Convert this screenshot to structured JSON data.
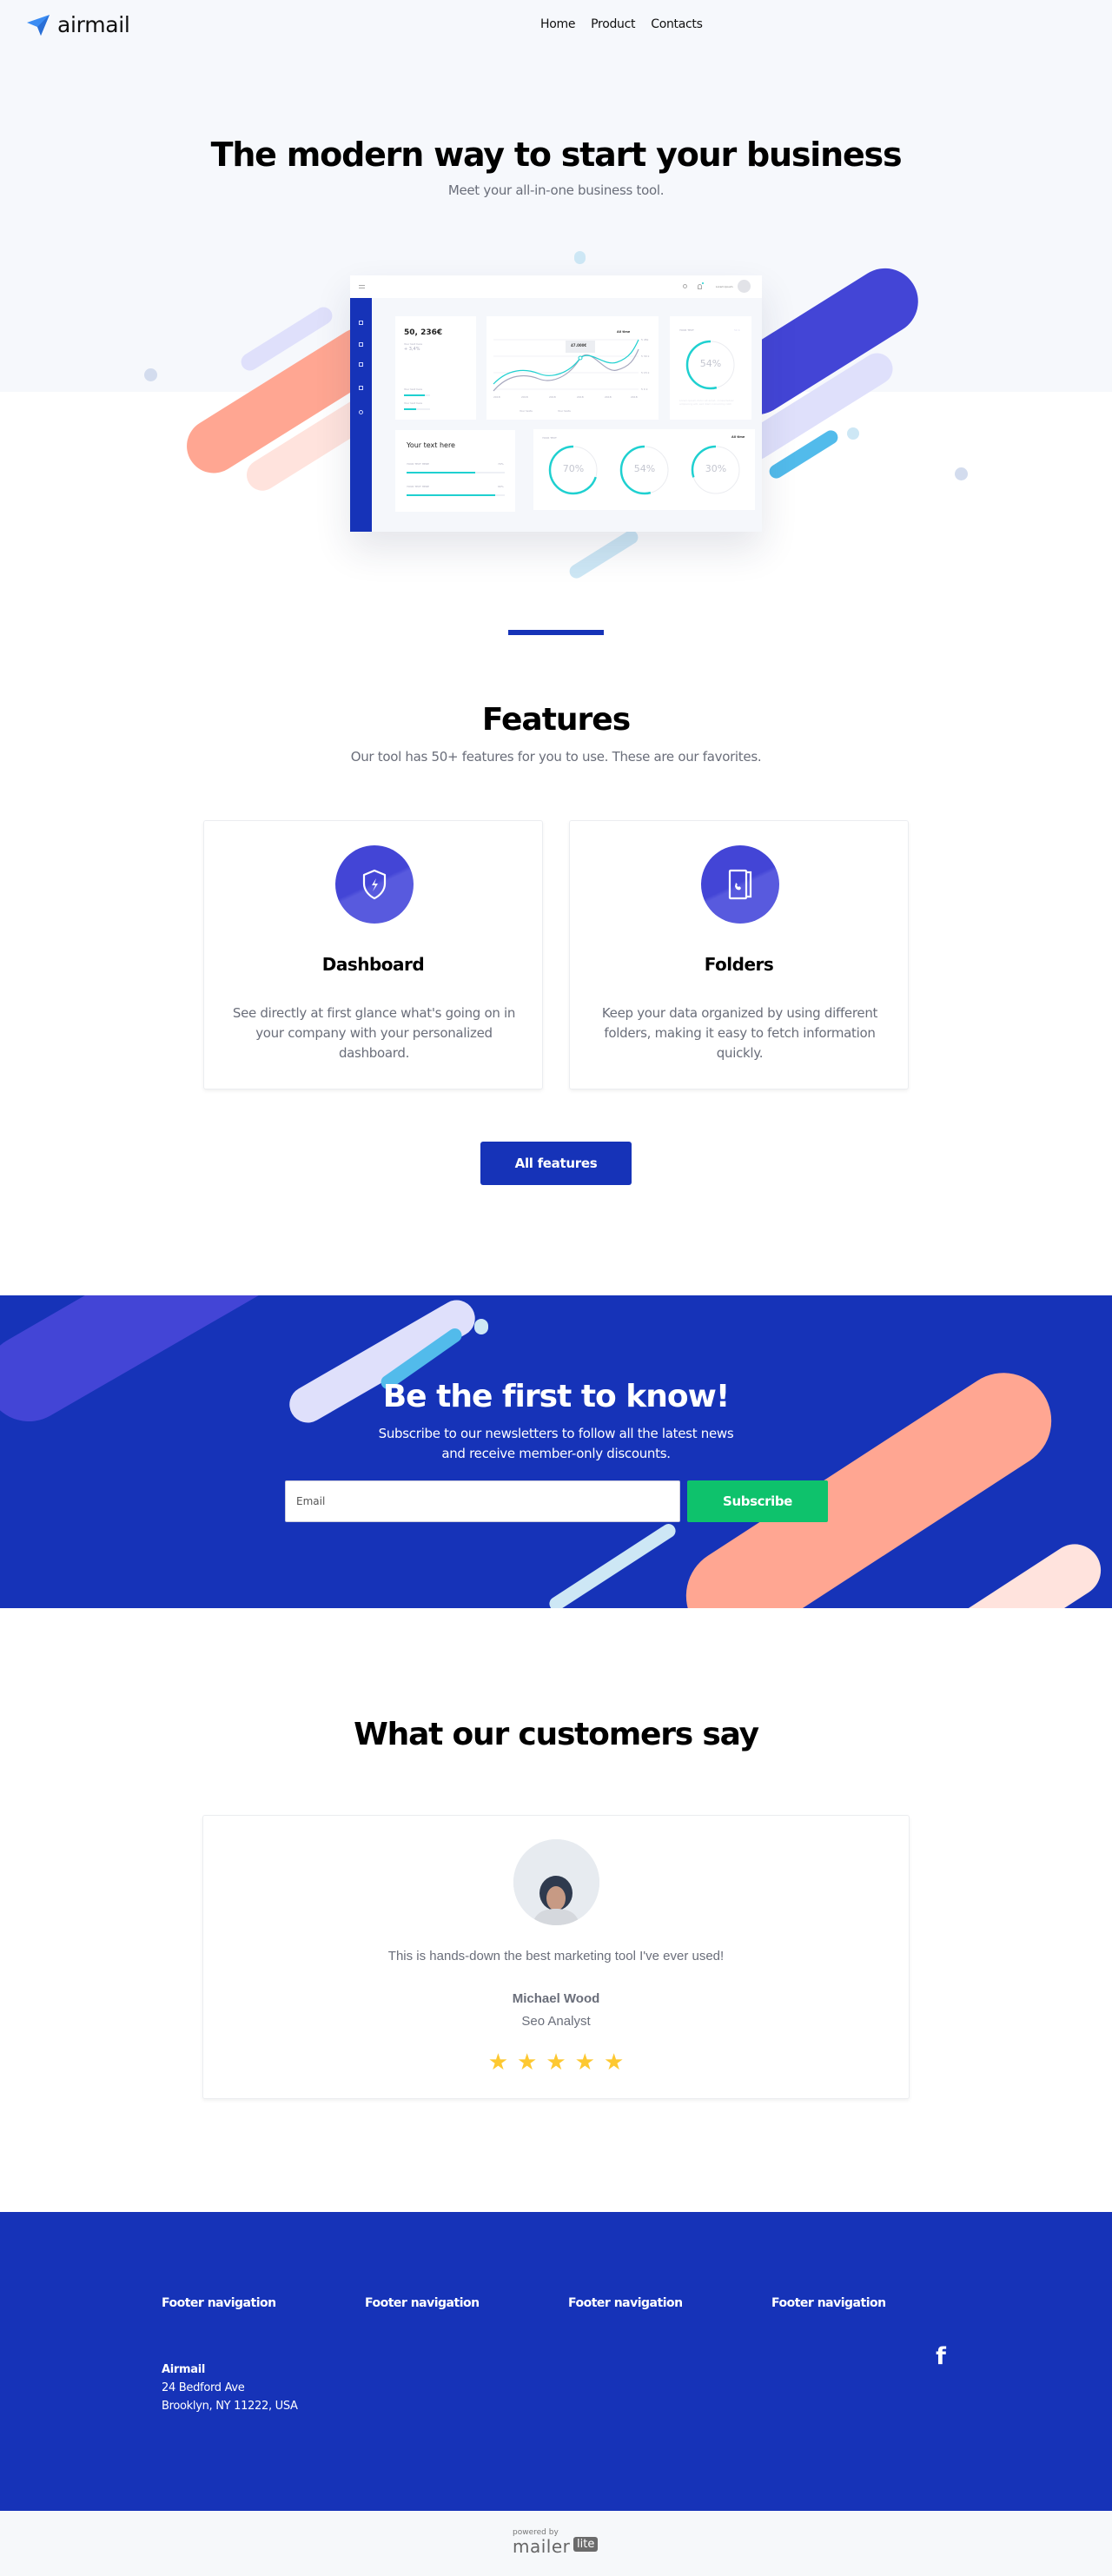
{
  "header": {
    "brand": "airmail",
    "nav": [
      {
        "label": "Home"
      },
      {
        "label": "Product"
      },
      {
        "label": "Contacts"
      }
    ]
  },
  "hero": {
    "title": "The modern way to start your business",
    "subtitle": "Meet your all-in-one business tool."
  },
  "dashboard_mock": {
    "user_label": "Lorem Ipsum",
    "balance": "50, 236€",
    "balance_caption": "Your text here",
    "balance_change": "+ 3,4%",
    "mini_bars": [
      {
        "label": "Your text here",
        "progress": 0.8
      },
      {
        "label": "Your text here",
        "progress": 0.45
      }
    ],
    "line_chart": {
      "filter": "All time",
      "tooltip_value": "47.000€",
      "tooltip_caption": "Your texts",
      "y_ticks": [
        "5 45k",
        "5 30 k",
        "5 15 k",
        "5 0 k"
      ],
      "x_ticks": [
        "2018",
        "2018",
        "2018",
        "2018",
        "2018",
        "2018"
      ],
      "legend": [
        "Your texts",
        "Your texts"
      ]
    },
    "donut_card": {
      "label": "YOUR TEXT",
      "value_label": "50 K",
      "percent": 54,
      "caption": "Lorem ipsum",
      "note": "Lorem ipsum dolor sit amet, consectetuer adipiscing elit, sed diam nonummy nibh"
    },
    "progress_card": {
      "title": "Your text here",
      "items": [
        {
          "label": "YOUR TEXT HERE",
          "percent": 70
        },
        {
          "label": "YOUR TEXT HERE",
          "percent": 90
        }
      ]
    },
    "donuts_row": {
      "label": "YOUR TEXT",
      "filter": "All time",
      "items": [
        {
          "percent": 70,
          "caption": "Lorem ipsum"
        },
        {
          "percent": 54,
          "caption": "Lorem ipsum"
        },
        {
          "percent": 30,
          "caption": "Lorem ipsum"
        }
      ]
    }
  },
  "features": {
    "title": "Features",
    "subtitle": "Our tool has 50+ features for you to use. These are our favorites.",
    "cards": [
      {
        "icon": "shield-bolt-icon",
        "name": "Dashboard",
        "description": "See directly at first glance what's going on in your company with your personalized dashboard."
      },
      {
        "icon": "phonebook-icon",
        "name": "Folders",
        "description": "Keep your data organized by using different folders, making it easy to fetch information quickly."
      }
    ],
    "cta_label": "All features"
  },
  "newsletter": {
    "title": "Be the first to know!",
    "subtitle_line1": "Subscribe to our newsletters to follow all the latest news",
    "subtitle_line2": "and receive member-only discounts.",
    "email_placeholder": "Email",
    "email_value": "",
    "button_label": "Subscribe"
  },
  "testimonials": {
    "title": "What our customers say",
    "items": [
      {
        "quote": "This is hands-down the best marketing tool I've ever used!",
        "name": "Michael Wood",
        "role": "Seo Analyst",
        "rating": 5,
        "rating_max": 5
      }
    ]
  },
  "footer": {
    "nav_headings": [
      "Footer navigation",
      "Footer navigation",
      "Footer navigation",
      "Footer navigation"
    ],
    "company": "Airmail",
    "address_line1": "24 Bedford Ave",
    "address_line2": "Brooklyn, NY 11222, USA",
    "social": [
      {
        "icon": "facebook-icon",
        "glyph": "f"
      }
    ]
  },
  "powered_by": {
    "small": "powered by",
    "brand": "mailer",
    "badge": "lite"
  },
  "colors": {
    "brand_blue": "#1633b8",
    "indigo": "#4345d6",
    "green": "#0ec26c",
    "teal": "#1fd0d0",
    "salmon": "#ffa692",
    "star": "#fdc831"
  }
}
